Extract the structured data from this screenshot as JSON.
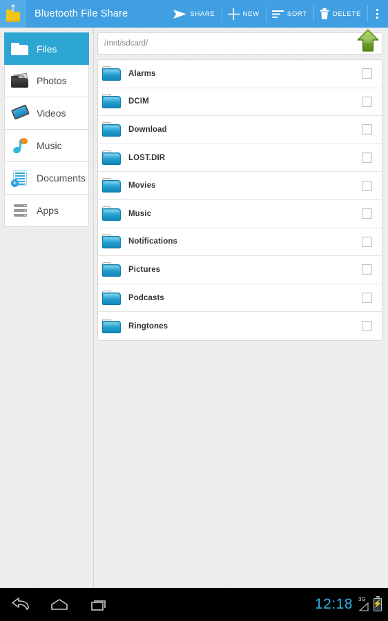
{
  "header": {
    "app_icon": "bluetooth-folder-icon",
    "title": "Bluetooth File Share",
    "brand_color": "#3f9fe2",
    "actions": [
      {
        "id": "share",
        "label": "SHARE",
        "icon": "send-icon"
      },
      {
        "id": "new",
        "label": "NEW",
        "icon": "plus-icon"
      },
      {
        "id": "sort",
        "label": "SORT",
        "icon": "sort-lines-icon"
      },
      {
        "id": "delete",
        "label": "DELETE",
        "icon": "trash-icon"
      }
    ],
    "overflow": {
      "icon": "overflow-menu-icon",
      "label": "More options"
    }
  },
  "sidebar": {
    "selected_color": "#2ea6d4",
    "items": [
      {
        "label": "Files",
        "icon": "folder-icon",
        "selected": true
      },
      {
        "label": "Photos",
        "icon": "photos-folder-icon",
        "selected": false
      },
      {
        "label": "Videos",
        "icon": "film-strip-icon",
        "selected": false
      },
      {
        "label": "Music",
        "icon": "music-note-icon",
        "selected": false
      },
      {
        "label": "Documents",
        "icon": "document-icon",
        "selected": false
      },
      {
        "label": "Apps",
        "icon": "apps-stack-icon",
        "selected": false
      }
    ]
  },
  "content": {
    "path": "/mnt/sdcard/",
    "path_placeholder": "/mnt/sdcard/",
    "up_button": {
      "icon": "arrow-up-icon",
      "label": "Up one level",
      "color": "#7cb22e"
    },
    "files": [
      {
        "name": "Alarms",
        "type": "folder",
        "checked": false
      },
      {
        "name": "DCIM",
        "type": "folder",
        "checked": false
      },
      {
        "name": "Download",
        "type": "folder",
        "checked": false
      },
      {
        "name": "LOST.DIR",
        "type": "folder",
        "checked": false
      },
      {
        "name": "Movies",
        "type": "folder",
        "checked": false
      },
      {
        "name": "Music",
        "type": "folder",
        "checked": false
      },
      {
        "name": "Notifications",
        "type": "folder",
        "checked": false
      },
      {
        "name": "Pictures",
        "type": "folder",
        "checked": false
      },
      {
        "name": "Podcasts",
        "type": "folder",
        "checked": false
      },
      {
        "name": "Ringtones",
        "type": "folder",
        "checked": false
      }
    ]
  },
  "navbar": {
    "buttons": [
      {
        "id": "back",
        "icon": "back-arrow-icon"
      },
      {
        "id": "home",
        "icon": "home-icon"
      },
      {
        "id": "recents",
        "icon": "recents-icon"
      }
    ],
    "clock": "12:18",
    "clock_color": "#33b5e5",
    "signal": {
      "label": "3G",
      "icon": "signal-triangle-icon"
    },
    "battery": {
      "icon": "battery-charging-icon"
    }
  }
}
